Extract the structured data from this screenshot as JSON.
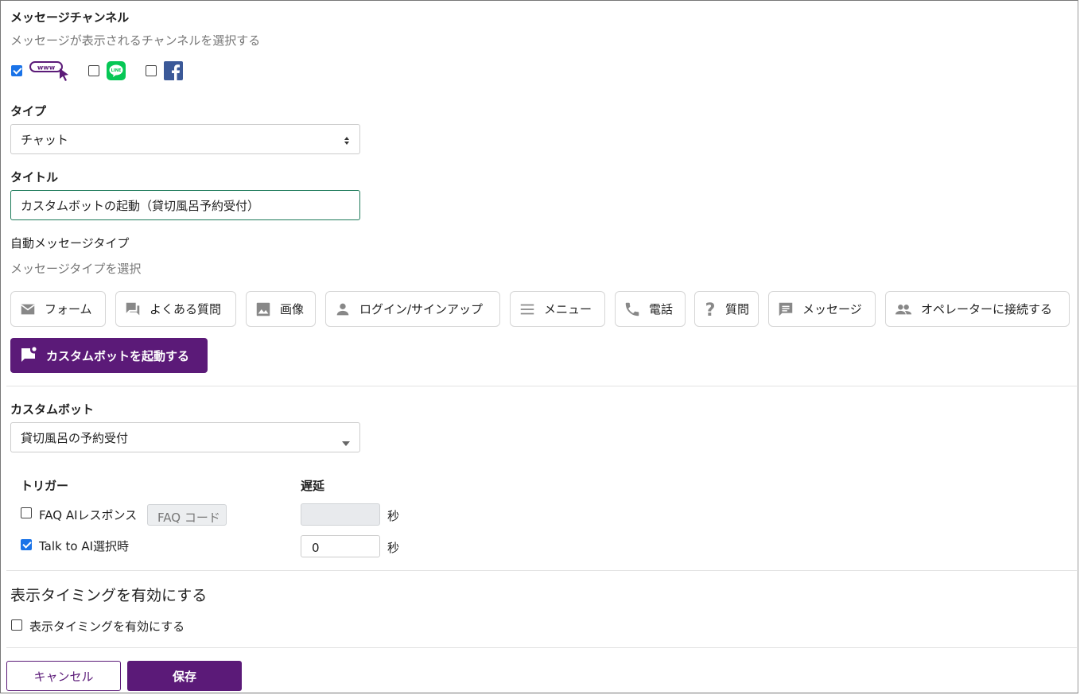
{
  "channel": {
    "title": "メッセージチャンネル",
    "subtitle": "メッセージが表示されるチャンネルを選択する",
    "www_label": "www",
    "line_label": "LINE",
    "items": [
      {
        "name": "web",
        "checked": true
      },
      {
        "name": "line",
        "checked": false
      },
      {
        "name": "facebook",
        "checked": false
      }
    ]
  },
  "type": {
    "label": "タイプ",
    "value": "チャット"
  },
  "title_field": {
    "label": "タイトル",
    "value": "カスタムボットの起動（貸切風呂予約受付）"
  },
  "auto_message": {
    "label": "自動メッセージタイプ",
    "subtitle": "メッセージタイプを選択",
    "chips": [
      {
        "label": "フォーム",
        "icon": "mail-icon"
      },
      {
        "label": "よくある質問",
        "icon": "forum-icon"
      },
      {
        "label": "画像",
        "icon": "image-icon"
      },
      {
        "label": "ログイン/サインアップ",
        "icon": "person-icon"
      },
      {
        "label": "メニュー",
        "icon": "menu-icon"
      },
      {
        "label": "電話",
        "icon": "phone-icon"
      },
      {
        "label": "質問",
        "icon": "question-icon"
      },
      {
        "label": "メッセージ",
        "icon": "message-icon"
      },
      {
        "label": "オペレーターに接続する",
        "icon": "people-icon"
      }
    ],
    "active_chip": {
      "label": "カスタムボットを起動する",
      "icon": "flag-chat-icon"
    }
  },
  "custom_bot": {
    "label": "カスタムボット",
    "value": "貸切風呂の予約受付"
  },
  "trigger": {
    "header": "トリガー",
    "delay_header": "遅延",
    "rows": [
      {
        "label": "FAQ AIレスポンス",
        "checked": false,
        "code_placeholder": "FAQ コード",
        "delay": "",
        "unit": "秒"
      },
      {
        "label": "Talk to AI選択時",
        "checked": true,
        "delay": "0",
        "unit": "秒"
      }
    ]
  },
  "timing": {
    "heading": "表示タイミングを有効にする",
    "checkbox_label": "表示タイミングを有効にする",
    "checked": false
  },
  "footer": {
    "cancel": "キャンセル",
    "save": "保存"
  },
  "colors": {
    "accent": "#5b1a78",
    "line_green": "#06c755",
    "facebook_blue": "#3b5998",
    "check_blue": "#1a73e8"
  }
}
